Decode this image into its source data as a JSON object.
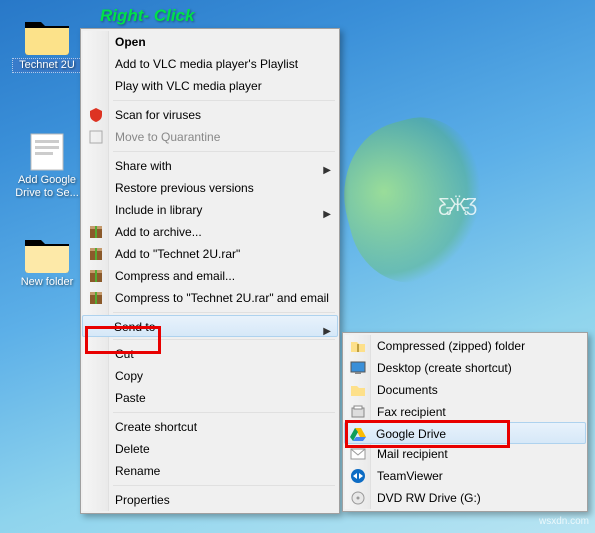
{
  "annotation": "Right- Click",
  "desktop_icons": {
    "technet": "Technet 2U",
    "addgoogle": "Add Google Drive to Se...",
    "newfolder": "New folder"
  },
  "main_menu": {
    "open": "Open",
    "vlc_playlist": "Add to VLC media player's Playlist",
    "vlc_play": "Play with VLC media player",
    "scan_viruses": "Scan for viruses",
    "quarantine": "Move to Quarantine",
    "share_with": "Share with",
    "restore_prev": "Restore previous versions",
    "include_lib": "Include in library",
    "add_archive": "Add to archive...",
    "add_rar": "Add to \"Technet 2U.rar\"",
    "compress_email": "Compress and email...",
    "compress_rar_email": "Compress to \"Technet 2U.rar\" and email",
    "send_to": "Send to",
    "cut": "Cut",
    "copy": "Copy",
    "paste": "Paste",
    "create_shortcut": "Create shortcut",
    "delete": "Delete",
    "rename": "Rename",
    "properties": "Properties"
  },
  "sub_menu": {
    "compressed": "Compressed (zipped) folder",
    "desktop_shortcut": "Desktop (create shortcut)",
    "documents": "Documents",
    "fax": "Fax recipient",
    "gdrive": "Google Drive",
    "mail": "Mail recipient",
    "teamviewer": "TeamViewer",
    "dvd": "DVD RW Drive (G:)"
  },
  "watermark": "wsxdn.com"
}
